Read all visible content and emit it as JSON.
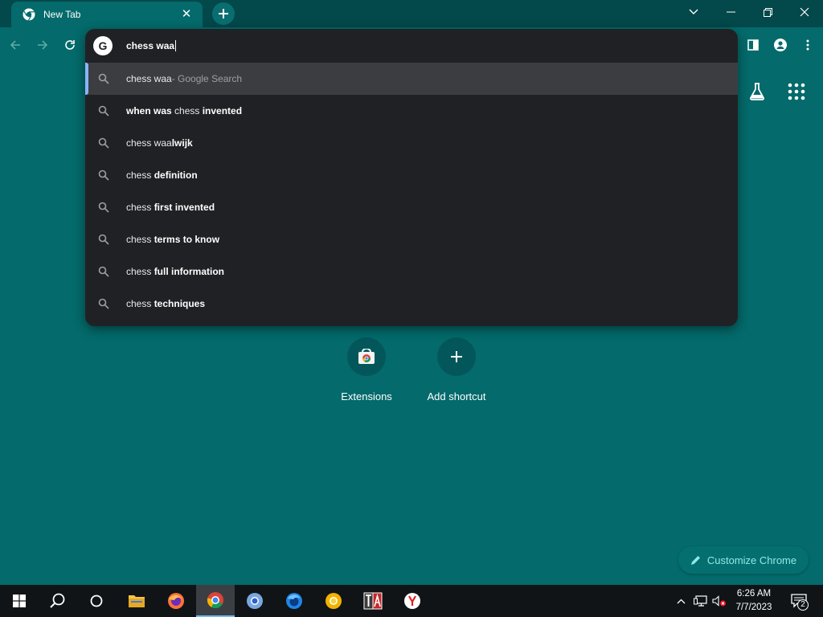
{
  "tab": {
    "title": "New Tab",
    "close_icon": "close-icon"
  },
  "omnibox": {
    "value": "chess waa",
    "engine_badge": "G"
  },
  "suggestions": [
    {
      "pre": "chess waa",
      "bold": "",
      "suffix": " - Google Search"
    },
    {
      "pre": "",
      "bold": "when was",
      "mid": " chess ",
      "bold2": "invented"
    },
    {
      "pre": "chess waa",
      "bold": "lwijk"
    },
    {
      "pre": "chess ",
      "bold": "definition"
    },
    {
      "pre": "chess ",
      "bold": "first invented"
    },
    {
      "pre": "chess ",
      "bold": "terms to know"
    },
    {
      "pre": "chess ",
      "bold": "full information"
    },
    {
      "pre": "chess ",
      "bold": "techniques"
    }
  ],
  "shortcuts": [
    {
      "label": "Extensions",
      "icon": "chrome-web-store-icon"
    },
    {
      "label": "Add shortcut",
      "icon": "plus-icon"
    }
  ],
  "customize_label": "Customize Chrome",
  "clock": {
    "time": "6:26 AM",
    "date": "7/7/2023"
  },
  "notification_count": "2",
  "colors": {
    "ntp_background": "#046a6b",
    "tabstrip": "#03484a",
    "omnibox_popup": "#202124",
    "accent_blue": "#8ab4f8"
  }
}
